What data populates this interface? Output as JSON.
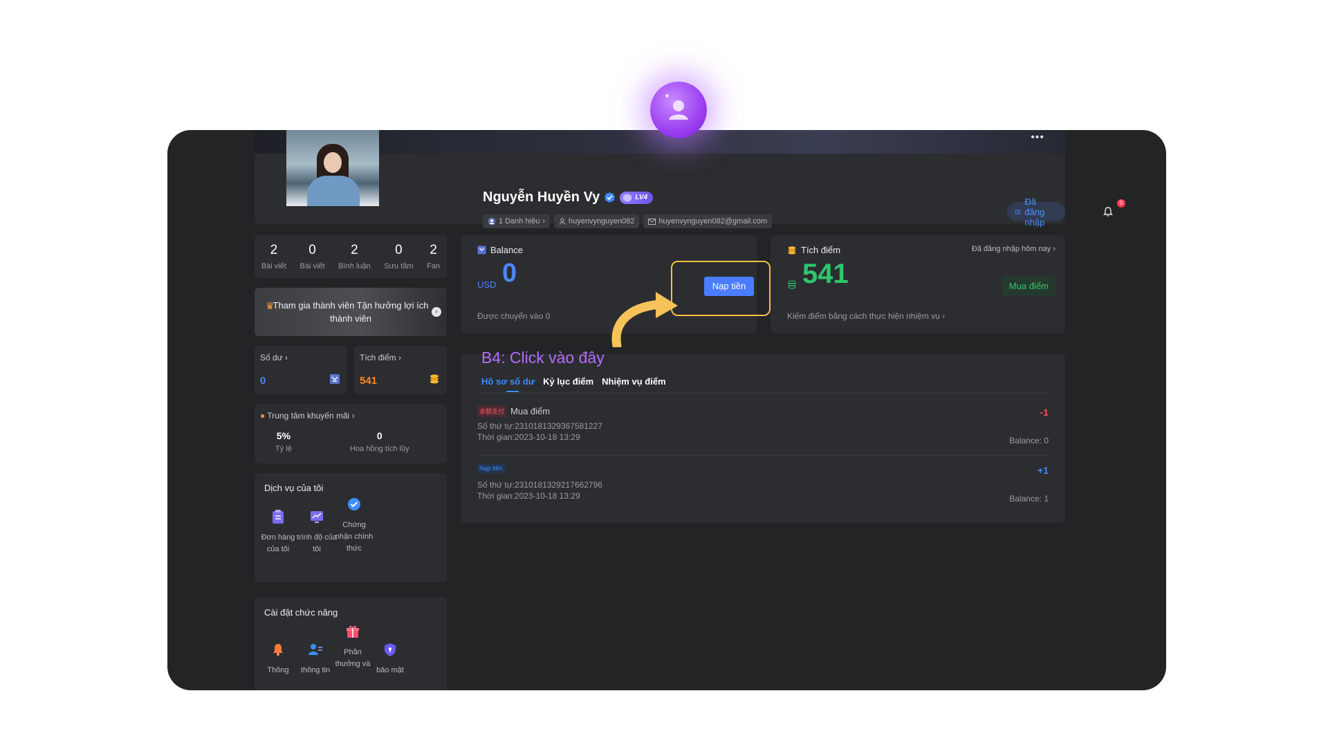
{
  "profile": {
    "name": "Nguyễn Huyền Vy",
    "level": "LV4",
    "title_tag": "1 Danh hiệu",
    "username": "huyenvynguyen082",
    "email": "huyenvynguyen082@gmail.com",
    "logged_in_label": "Đã đăng nhập",
    "notification_count": "0"
  },
  "stats": [
    {
      "num": "2",
      "label": "Bài viết"
    },
    {
      "num": "0",
      "label": "Bài viết"
    },
    {
      "num": "2",
      "label": "Bình luận"
    },
    {
      "num": "0",
      "label": "Sưu tầm"
    },
    {
      "num": "2",
      "label": "Fan"
    }
  ],
  "member_banner": "Tham gia thành viên Tận hưởng lợi ích thành viên",
  "wallet": {
    "balance_title": "Số dư",
    "balance_value": "0",
    "points_title": "Tích điểm",
    "points_value": "541"
  },
  "promo": {
    "title": "Trung tâm khuyến mãi",
    "rate_value": "5%",
    "rate_label": "Tỷ lệ",
    "commission_value": "0",
    "commission_label": "Hoa hồng tích lũy"
  },
  "services": {
    "title": "Dịch vụ của tôi",
    "items": [
      "Đơn hàng của tôi",
      "trình độ của tôi",
      "Chứng nhận chính thức"
    ]
  },
  "settings": {
    "title": "Cài đặt chức năng",
    "items": [
      "Thông",
      "thông tin",
      "Phần thưởng và",
      "bảo mật"
    ]
  },
  "balance_card": {
    "title": "Balance",
    "currency": "USD",
    "amount": "0",
    "transferred": "Được chuyển vào 0",
    "topup_button": "Nạp tiền"
  },
  "points_card": {
    "title": "Tích điểm",
    "daily_login": "Đã đăng nhập hôm nay",
    "amount": "541",
    "buy_button": "Mua điểm",
    "earn_hint": "Kiếm điểm bằng cách thực hiện nhiệm vụ"
  },
  "annotation": "B4: Click vào đây",
  "tabs": [
    "Hồ sơ số dư",
    "Kỷ lục điểm",
    "Nhiệm vụ điểm"
  ],
  "records": [
    {
      "badge": "余额支付",
      "badge_color": "#ff5a6e",
      "title": "Mua điểm",
      "order": "Số thứ tự:2310181329367581227",
      "time": "Thời gian:2023-10-18 13:29",
      "amount": "-1",
      "amount_color": "#ff4d5e",
      "balance": "Balance: 0"
    },
    {
      "badge": "Nạp tiền",
      "badge_color": "#3d8dff",
      "title": "",
      "order": "Số thứ tự:2310181329217662796",
      "time": "Thời gian:2023-10-18 13:29",
      "amount": "+1",
      "amount_color": "#3d8dff",
      "balance": "Balance: 1"
    }
  ],
  "colors": {
    "accent_blue": "#4a7dff",
    "points_green": "#2dc76d",
    "points_orange": "#ff8a1f",
    "highlight": "#f5c04a",
    "annotation": "#b46cff"
  }
}
